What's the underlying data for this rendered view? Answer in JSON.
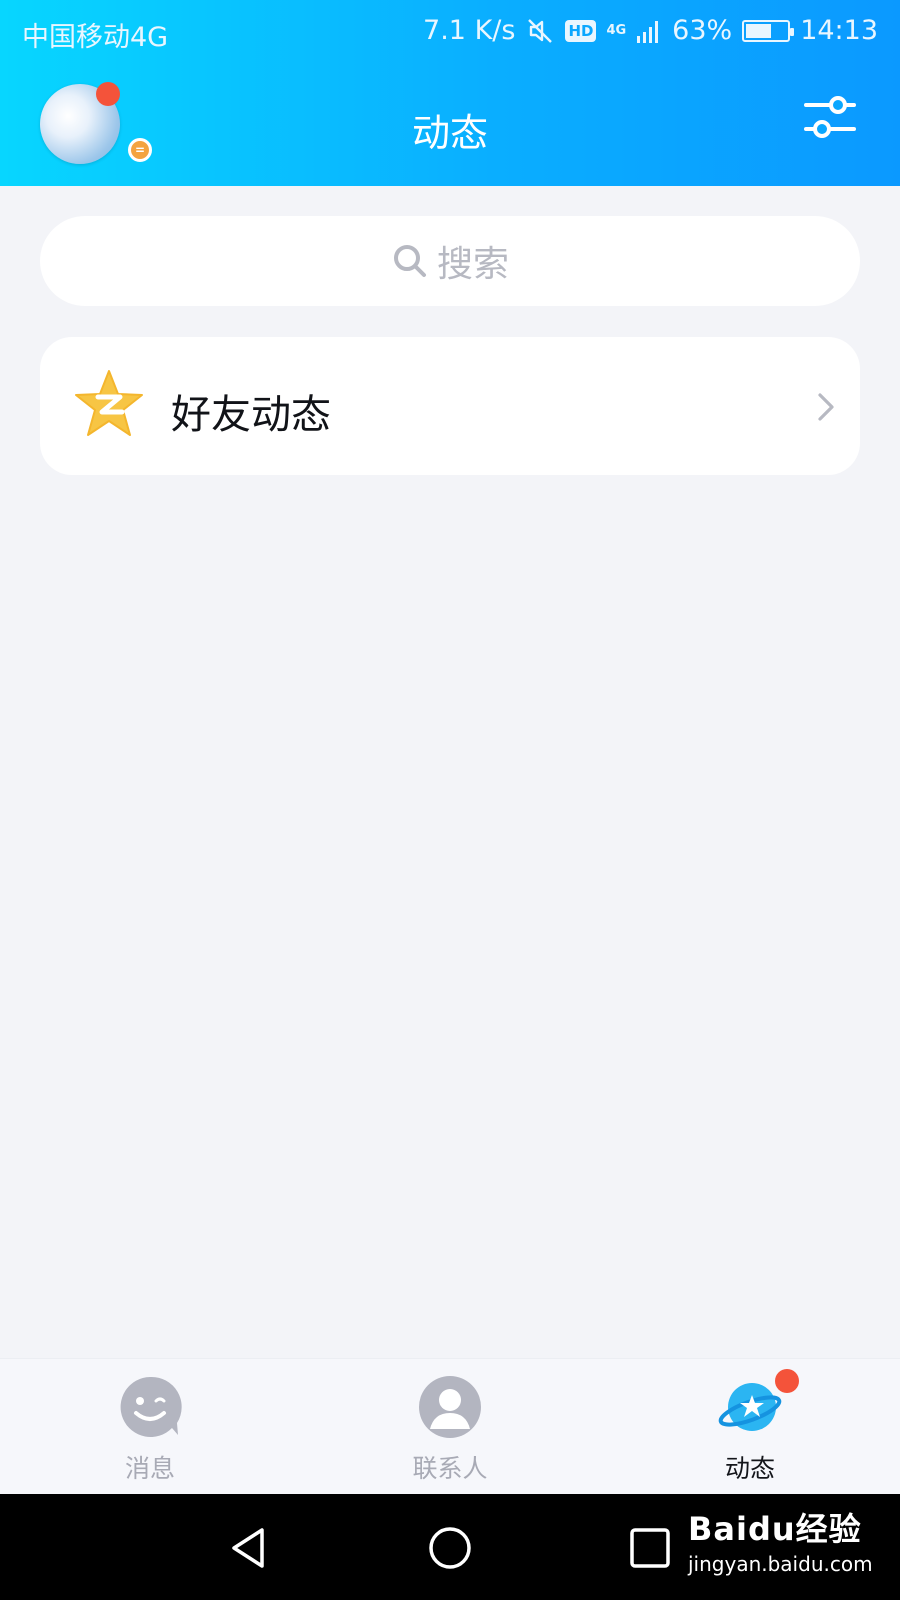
{
  "status_bar": {
    "carrier": "中国移动4G",
    "speed": "7.1 K/s",
    "hd": "HD",
    "network": "4G",
    "battery_percent": "63%",
    "battery_level": 0.63,
    "time": "14:13"
  },
  "header": {
    "title": "动态",
    "avatar_badge": "=",
    "colors": {
      "gradient_start": "#07d6ff",
      "gradient_end": "#0b99ff"
    }
  },
  "search": {
    "label": "搜索"
  },
  "items": [
    {
      "label": "好友动态",
      "icon": "qzone-star-icon"
    }
  ],
  "tabbar": {
    "tabs": [
      {
        "label": "消息",
        "icon": "message-icon",
        "active": false
      },
      {
        "label": "联系人",
        "icon": "contacts-icon",
        "active": false
      },
      {
        "label": "动态",
        "icon": "planet-icon",
        "active": true
      }
    ]
  },
  "watermark": {
    "logo": "Baidu经验",
    "url": "jingyan.baidu.com"
  },
  "colors": {
    "badge_red": "#f4533a",
    "accent": "#0aaeff",
    "background": "#f3f4f8"
  }
}
